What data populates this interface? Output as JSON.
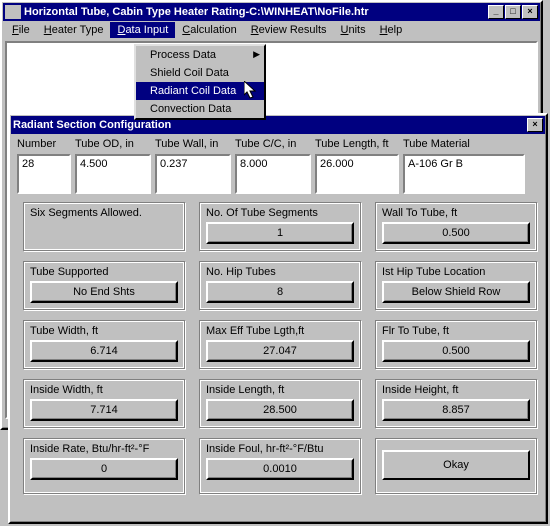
{
  "main_window": {
    "title": "Horizontal Tube, Cabin Type Heater Rating-C:\\WINHEAT\\NoFile.htr",
    "menus": {
      "file": "File",
      "heater_type": "Heater Type",
      "data_input": "Data Input",
      "calculation": "Calculation",
      "review_results": "Review Results",
      "units": "Units",
      "help": "Help"
    },
    "dropdown": {
      "process_data": "Process Data",
      "shield_coil_data": "Shield Coil Data",
      "radiant_coil_data": "Radiant Coil Data",
      "convection_data": "Convection Data"
    }
  },
  "dialog": {
    "title": "Radiant Section Configuration",
    "top": {
      "number": {
        "label": "Number",
        "value": "28"
      },
      "tube_od": {
        "label": "Tube OD, in",
        "value": "4.500"
      },
      "tube_wall": {
        "label": "Tube Wall, in",
        "value": "0.237"
      },
      "tube_cc": {
        "label": "Tube C/C, in",
        "value": "8.000"
      },
      "tube_length": {
        "label": "Tube Length, ft",
        "value": "26.000"
      },
      "tube_material": {
        "label": "Tube Material",
        "value": "A-106 Gr B"
      }
    },
    "groups": {
      "six_segments": {
        "label": "Six Segments Allowed."
      },
      "no_tube_segments": {
        "label": "No. Of Tube Segments",
        "value": "1"
      },
      "wall_to_tube": {
        "label": "Wall To Tube, ft",
        "value": "0.500"
      },
      "tube_supported": {
        "label": "Tube Supported",
        "value": "No End Shts"
      },
      "no_hip_tubes": {
        "label": "No. Hip Tubes",
        "value": "8"
      },
      "first_hip_tube_loc": {
        "label": "Ist Hip Tube Location",
        "value": "Below Shield Row"
      },
      "tube_width": {
        "label": "Tube Width, ft",
        "value": "6.714"
      },
      "max_eff_tube_lgth": {
        "label": "Max Eff Tube Lgth,ft",
        "value": "27.047"
      },
      "flr_to_tube": {
        "label": "Flr To Tube, ft",
        "value": "0.500"
      },
      "inside_width": {
        "label": "Inside Width, ft",
        "value": "7.714"
      },
      "inside_length": {
        "label": "Inside Length, ft",
        "value": "28.500"
      },
      "inside_height": {
        "label": "Inside Height, ft",
        "value": "8.857"
      },
      "inside_rate": {
        "label": "Inside Rate, Btu/hr-ft²-°F",
        "value": "0"
      },
      "inside_foul": {
        "label": "Inside Foul, hr-ft²-°F/Btu",
        "value": "0.0010"
      },
      "okay": {
        "label": "Okay"
      }
    }
  }
}
